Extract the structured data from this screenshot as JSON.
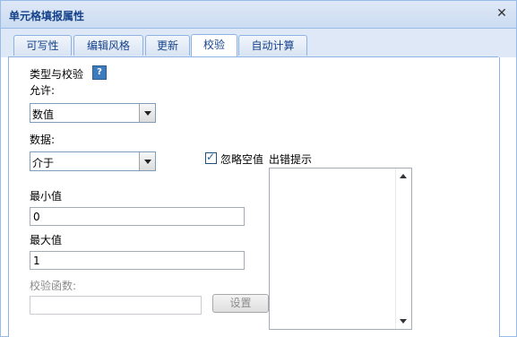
{
  "window": {
    "title": "单元格填报属性",
    "close_glyph": "✕"
  },
  "tabs": [
    {
      "label": "可写性"
    },
    {
      "label": "编辑风格"
    },
    {
      "label": "更新"
    },
    {
      "label": "校验"
    },
    {
      "label": "自动计算"
    }
  ],
  "validation": {
    "section_title": "类型与校验",
    "allow_label": "允许:",
    "allow_value": "数值",
    "data_label": "数据:",
    "data_value": "介于",
    "ignore_blank_label": "忽略空值",
    "error_prompt_label": "出错提示",
    "min_label": "最小值",
    "min_value": "0",
    "max_label": "最大值",
    "max_value": "1",
    "func_label": "校验函数:",
    "func_value": "",
    "settings_button": "设置",
    "help_glyph": "?"
  }
}
